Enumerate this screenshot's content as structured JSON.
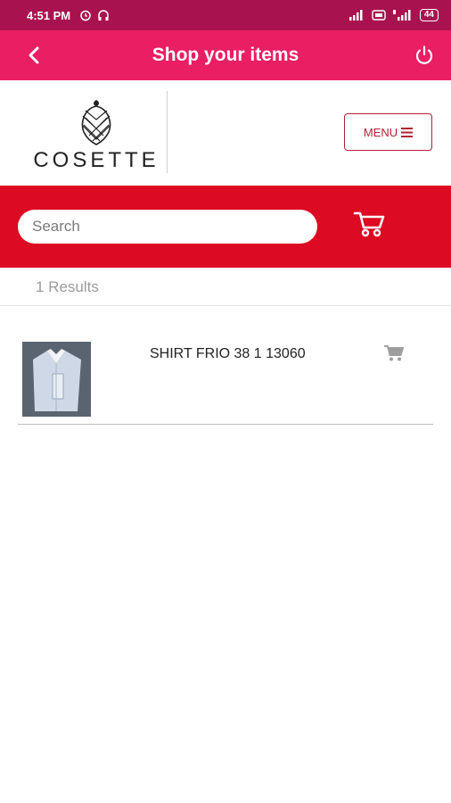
{
  "status_bar": {
    "time": "4:51 PM",
    "battery": "44"
  },
  "app_bar": {
    "title": "Shop your items",
    "back_icon": "chevron-left-icon",
    "power_icon": "power-icon"
  },
  "brand": {
    "logo_text": "COSETTE",
    "menu_label": "MENU"
  },
  "search": {
    "placeholder": "Search"
  },
  "results": {
    "count_label": "1 Results"
  },
  "products": [
    {
      "name": "SHIRT FRIO 38 1 13060"
    }
  ],
  "colors": {
    "status_bar": "#a8134f",
    "app_bar": "#e91e63",
    "search_band": "#dc0a22",
    "menu_border": "#b22234"
  }
}
